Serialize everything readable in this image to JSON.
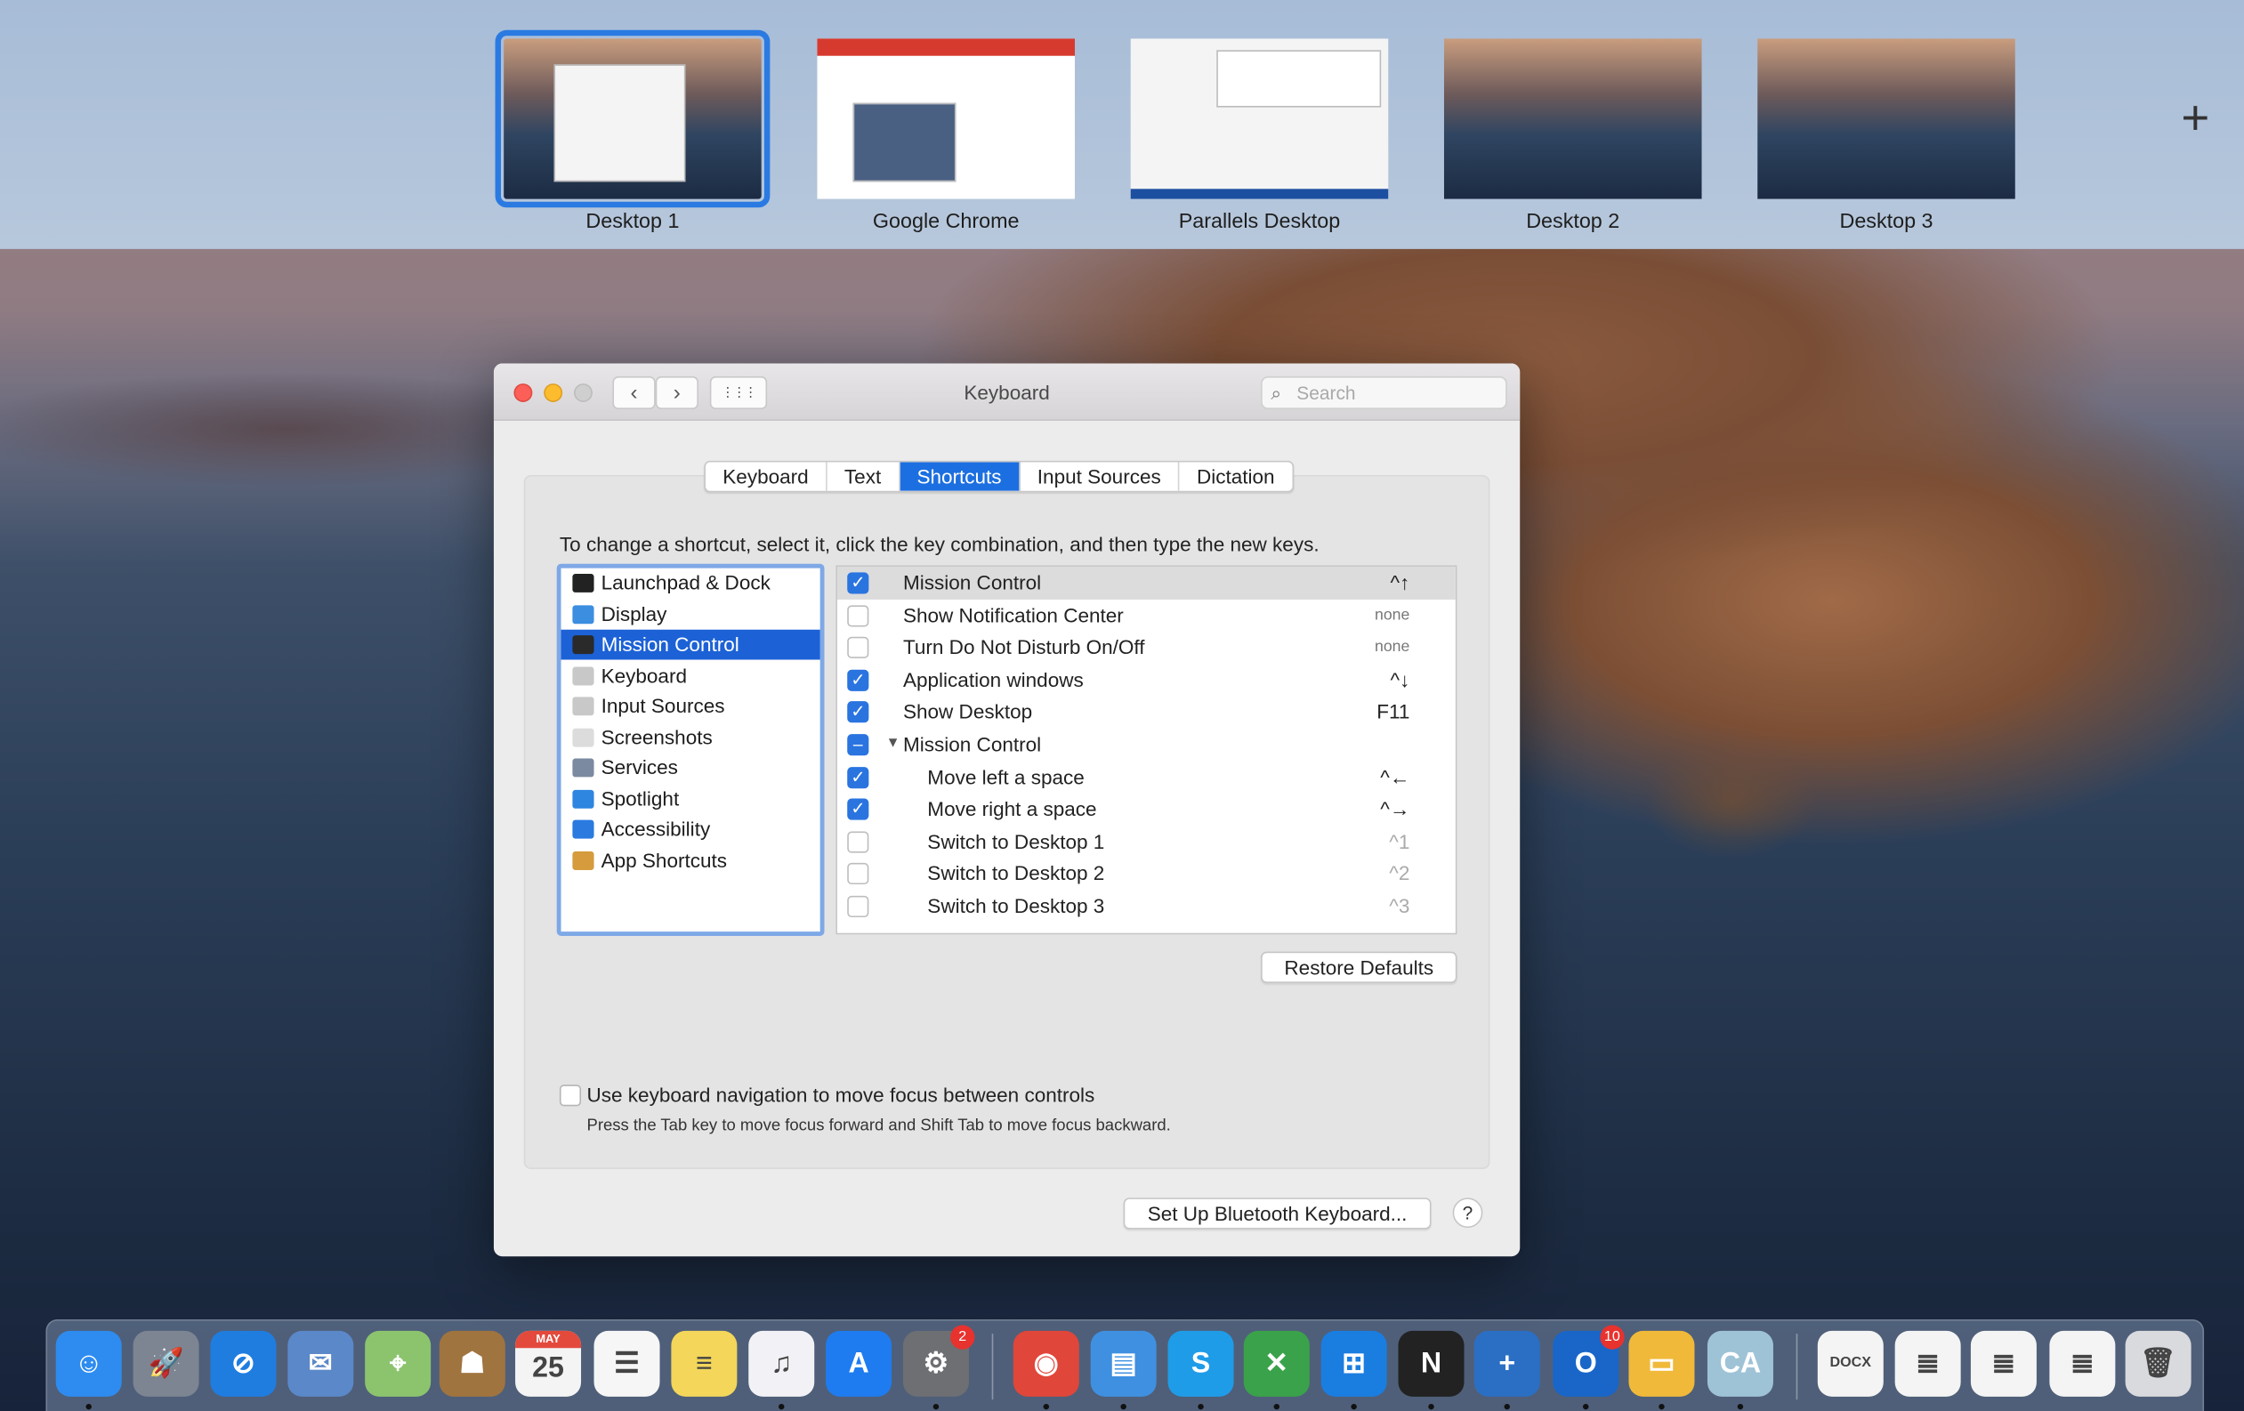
{
  "spaces": {
    "items": [
      {
        "label": "Desktop 1",
        "selected": true
      },
      {
        "label": "Google Chrome",
        "selected": false
      },
      {
        "label": "Parallels Desktop",
        "selected": false
      },
      {
        "label": "Desktop 2",
        "selected": false
      },
      {
        "label": "Desktop 3",
        "selected": false
      }
    ],
    "add_icon": "plus-icon",
    "add_label": "+"
  },
  "window": {
    "title": "Keyboard",
    "back": "‹",
    "forward": "›",
    "grid": "⋮⋮⋮",
    "search_placeholder": "Search",
    "tabs": [
      {
        "label": "Keyboard"
      },
      {
        "label": "Text"
      },
      {
        "label": "Shortcuts",
        "active": true
      },
      {
        "label": "Input Sources"
      },
      {
        "label": "Dictation"
      }
    ],
    "instruction": "To change a shortcut, select it, click the key combination, and then type the new keys.",
    "categories": [
      {
        "label": "Launchpad & Dock",
        "icon": "launchpad-dock-icon",
        "color": "#222"
      },
      {
        "label": "Display",
        "icon": "display-icon",
        "color": "#3b8ee0"
      },
      {
        "label": "Mission Control",
        "icon": "mission-control-icon",
        "color": "#2a2a2a",
        "selected": true
      },
      {
        "label": "Keyboard",
        "icon": "keyboard-icon",
        "color": "#c8c8c8"
      },
      {
        "label": "Input Sources",
        "icon": "input-sources-icon",
        "color": "#c8c8c8"
      },
      {
        "label": "Screenshots",
        "icon": "screenshots-icon",
        "color": "#dcdcdc"
      },
      {
        "label": "Services",
        "icon": "gear-icon",
        "color": "#7b8aa0"
      },
      {
        "label": "Spotlight",
        "icon": "spotlight-icon",
        "color": "#2f86e0"
      },
      {
        "label": "Accessibility",
        "icon": "accessibility-icon",
        "color": "#2a7ae0"
      },
      {
        "label": "App Shortcuts",
        "icon": "app-shortcuts-icon",
        "color": "#d59b3c"
      }
    ],
    "shortcuts": [
      {
        "name": "Mission Control",
        "key": "^↑",
        "checked": "on",
        "highlight": true
      },
      {
        "name": "Show Notification Center",
        "key": "none",
        "checked": "off"
      },
      {
        "name": "Turn Do Not Disturb On/Off",
        "key": "none",
        "checked": "off"
      },
      {
        "name": "Application windows",
        "key": "^↓",
        "checked": "on"
      },
      {
        "name": "Show Desktop",
        "key": "F11",
        "checked": "on"
      },
      {
        "name": "Mission Control",
        "key": "",
        "checked": "mixed",
        "group": true
      },
      {
        "name": "Move left a space",
        "key": "^←",
        "checked": "on",
        "indent": true
      },
      {
        "name": "Move right a space",
        "key": "^→",
        "checked": "on",
        "indent": true
      },
      {
        "name": "Switch to Desktop 1",
        "key": "^1",
        "checked": "off",
        "indent": true
      },
      {
        "name": "Switch to Desktop 2",
        "key": "^2",
        "checked": "off",
        "indent": true
      },
      {
        "name": "Switch to Desktop 3",
        "key": "^3",
        "checked": "off",
        "indent": true
      }
    ],
    "restore_defaults": "Restore Defaults",
    "keyboard_nav_label": "Use keyboard navigation to move focus between controls",
    "keyboard_nav_sub": "Press the Tab key to move focus forward and Shift Tab to move focus backward.",
    "bluetooth_button": "Set Up Bluetooth Keyboard...",
    "help": "?"
  },
  "dock": {
    "items": [
      {
        "name": "finder",
        "glyph": "☺",
        "color": "#2e8cf0",
        "running": true
      },
      {
        "name": "launchpad",
        "glyph": "🚀",
        "color": "#7c8591"
      },
      {
        "name": "safari",
        "glyph": "⊘",
        "color": "#1f7de0"
      },
      {
        "name": "mail",
        "glyph": "✉",
        "color": "#5b88c8"
      },
      {
        "name": "maps",
        "glyph": "⌖",
        "color": "#8cc46e"
      },
      {
        "name": "contacts",
        "glyph": "☗",
        "color": "#a0743f"
      },
      {
        "name": "calendar",
        "glyph": "25",
        "sub": "MAY",
        "color": "#f4f4f4"
      },
      {
        "name": "reminders",
        "glyph": "☰",
        "color": "#f6f6f6"
      },
      {
        "name": "notes",
        "glyph": "≡",
        "color": "#f3d65a"
      },
      {
        "name": "music",
        "glyph": "♫",
        "color": "#f2f2f6",
        "running": true
      },
      {
        "name": "app-store",
        "glyph": "A",
        "color": "#1e7cf0"
      },
      {
        "name": "system-preferences",
        "glyph": "⚙",
        "color": "#6d6f73",
        "badge": "2",
        "running": true
      },
      {
        "name": "chrome",
        "glyph": "◉",
        "color": "#e0463a",
        "running": true
      },
      {
        "name": "parallels-vm",
        "glyph": "▤",
        "color": "#3f90e0",
        "running": true
      },
      {
        "name": "skype",
        "glyph": "S",
        "color": "#1f9ce8",
        "running": true
      },
      {
        "name": "crossover",
        "glyph": "✕",
        "color": "#3aa24a",
        "running": true
      },
      {
        "name": "windows",
        "glyph": "⊞",
        "color": "#1a7de0",
        "running": true
      },
      {
        "name": "app-n",
        "glyph": "N",
        "color": "#222",
        "running": true
      },
      {
        "name": "plus-app",
        "glyph": "+",
        "color": "#2b6fc4",
        "running": true
      },
      {
        "name": "outlook",
        "glyph": "O",
        "color": "#1966c8",
        "badge": "10",
        "running": true
      },
      {
        "name": "file-explorer",
        "glyph": "▭",
        "color": "#f0b93a",
        "running": true
      },
      {
        "name": "ca-app",
        "glyph": "CA",
        "color": "#9fc3d6",
        "running": true
      },
      {
        "name": "docx-document",
        "glyph": "DOCX",
        "color": "#f4f4f4"
      },
      {
        "name": "chrome-document",
        "glyph": "≣",
        "color": "#f4f4f4"
      },
      {
        "name": "skype-document",
        "glyph": "≣",
        "color": "#f4f4f4"
      },
      {
        "name": "chrome-document-2",
        "glyph": "≣",
        "color": "#f4f4f4"
      },
      {
        "name": "trash",
        "glyph": "🗑",
        "color": "#d8dadd"
      }
    ]
  }
}
